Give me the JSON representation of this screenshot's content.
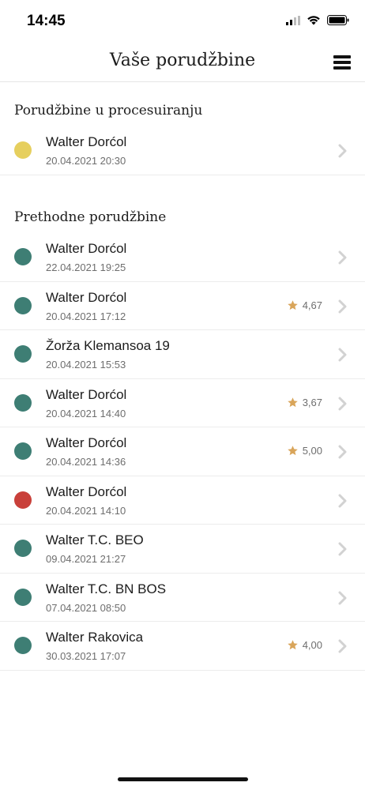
{
  "status_bar": {
    "time": "14:45"
  },
  "nav": {
    "title": "Vaše porudžbine"
  },
  "colors": {
    "pending": "#e6cf5e",
    "completed": "#3e7e74",
    "cancelled": "#c9403a",
    "star": "#d9a55a"
  },
  "processing": {
    "title": "Porudžbine u procesuiranju",
    "orders": [
      {
        "name": "Walter Dorćol",
        "date": "20.04.2021 20:30",
        "status": "pending",
        "rating": ""
      }
    ]
  },
  "previous": {
    "title": "Prethodne porudžbine",
    "orders": [
      {
        "name": "Walter Dorćol",
        "date": "22.04.2021 19:25",
        "status": "completed",
        "rating": ""
      },
      {
        "name": "Walter Dorćol",
        "date": "20.04.2021 17:12",
        "status": "completed",
        "rating": "4,67"
      },
      {
        "name": "Žorža Klemansoa 19",
        "date": "20.04.2021 15:53",
        "status": "completed",
        "rating": ""
      },
      {
        "name": "Walter Dorćol",
        "date": "20.04.2021 14:40",
        "status": "completed",
        "rating": "3,67"
      },
      {
        "name": "Walter Dorćol",
        "date": "20.04.2021 14:36",
        "status": "completed",
        "rating": "5,00"
      },
      {
        "name": "Walter Dorćol",
        "date": "20.04.2021 14:10",
        "status": "cancelled",
        "rating": ""
      },
      {
        "name": "Walter T.C. BEO",
        "date": "09.04.2021 21:27",
        "status": "completed",
        "rating": ""
      },
      {
        "name": "Walter T.C. BN BOS",
        "date": "07.04.2021 08:50",
        "status": "completed",
        "rating": ""
      },
      {
        "name": "Walter Rakovica",
        "date": "30.03.2021 17:07",
        "status": "completed",
        "rating": "4,00"
      }
    ]
  }
}
